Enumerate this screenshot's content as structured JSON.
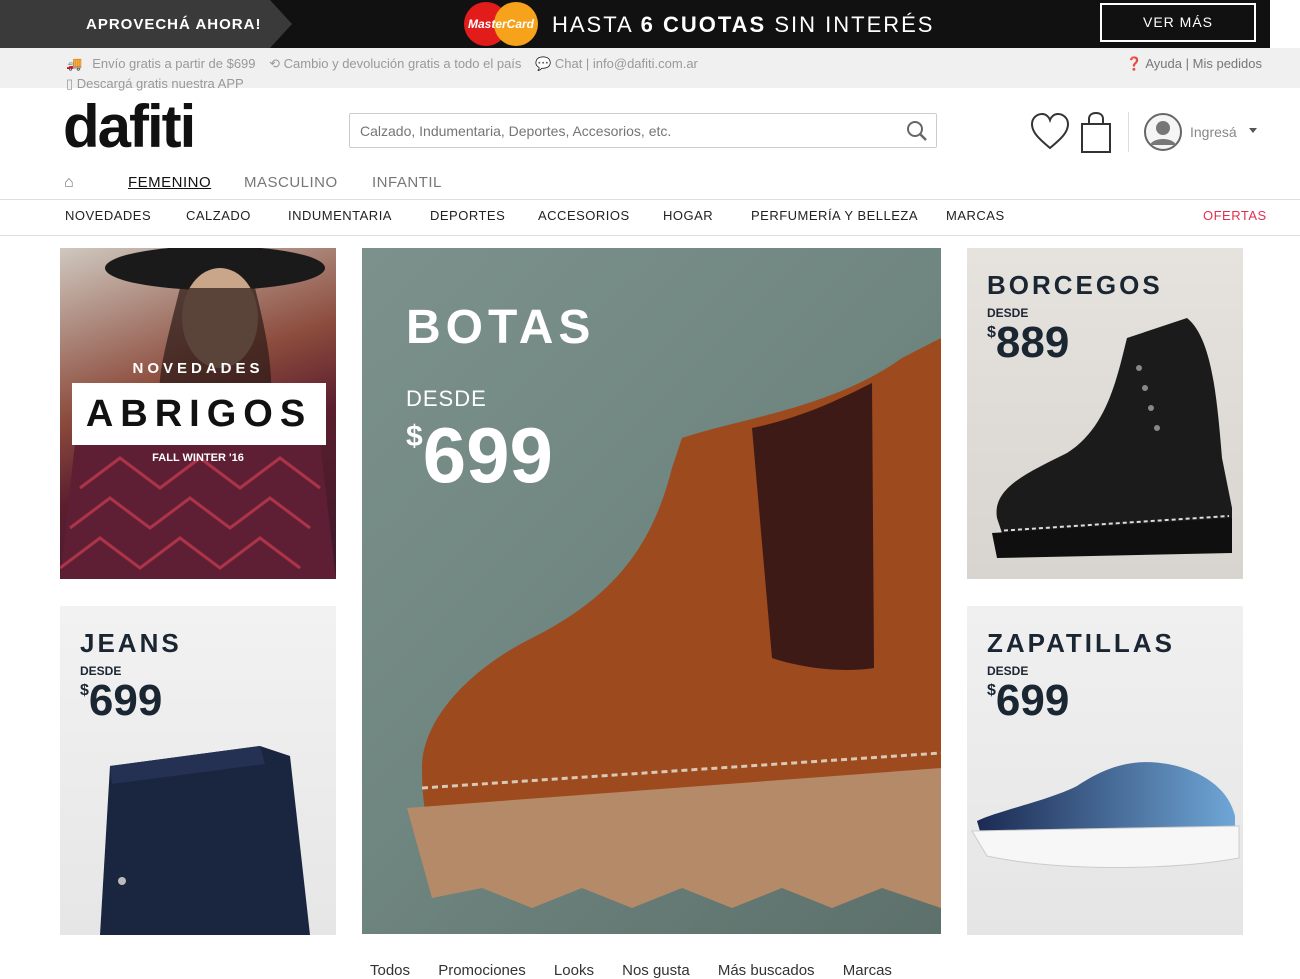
{
  "promo": {
    "left_text": "APROVECHÁ AHORA!",
    "card_brand": "MasterCard",
    "pre": "HASTA ",
    "bold": "6 CUOTAS",
    "post": " SIN INTERÉS",
    "cta": "VER MÁS"
  },
  "infobar": {
    "shipping": "Envío gratis a partir de $699",
    "returns": "Cambio y devolución gratis a todo el país",
    "chat": "Chat | info@dafiti.com.ar",
    "app": "Descargá gratis nuestra APP",
    "help": "Ayuda",
    "orders": "| Mis pedidos"
  },
  "header": {
    "logo": "dafiti",
    "search_placeholder": "Calzado, Indumentaria, Deportes, Accesorios, etc.",
    "login": "Ingresá"
  },
  "tabs": [
    "FEMENINO",
    "MASCULINO",
    "INFANTIL"
  ],
  "categories": [
    "NOVEDADES",
    "CALZADO",
    "INDUMENTARIA",
    "DEPORTES",
    "ACCESORIOS",
    "HOGAR",
    "PERFUMERÍA Y BELLEZA",
    "MARCAS",
    "OFERTAS"
  ],
  "tiles": {
    "abrigos": {
      "kicker": "NOVEDADES",
      "title": "ABRIGOS",
      "season": "FALL WINTER '16"
    },
    "botas": {
      "title": "BOTAS",
      "desde": "DESDE",
      "currency": "$",
      "price": "699"
    },
    "borcegos": {
      "title": "BORCEGOS",
      "desde": "DESDE",
      "currency": "$",
      "price": "889"
    },
    "jeans": {
      "title": "JEANS",
      "desde": "DESDE",
      "currency": "$",
      "price": "699"
    },
    "zapatillas": {
      "title": "ZAPATILLAS",
      "desde": "DESDE",
      "currency": "$",
      "price": "699"
    }
  },
  "bottom_nav": [
    "Todos",
    "Promociones",
    "Looks",
    "Nos gusta",
    "Más buscados",
    "Marcas"
  ],
  "colors": {
    "accent": "#e2304f",
    "promo_bg": "#111111"
  }
}
